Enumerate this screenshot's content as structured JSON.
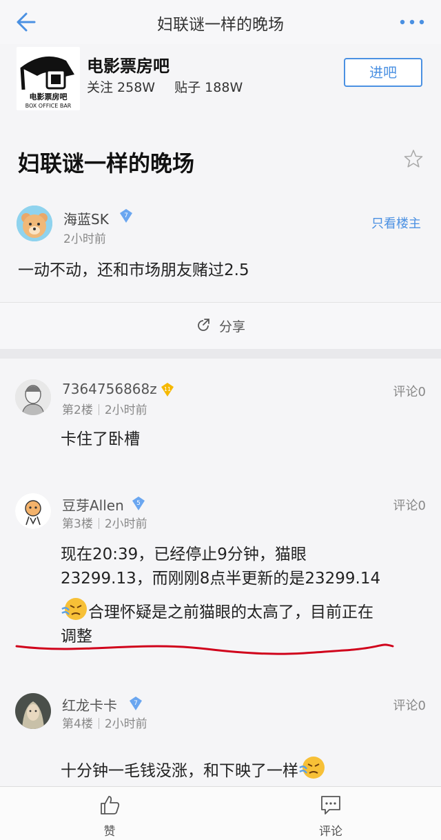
{
  "header": {
    "title": "妇联谜一样的晚场"
  },
  "forum": {
    "name": "电影票房吧",
    "followers": "关注 258W",
    "posts": "贴子 188W",
    "logo_text_cn": "电影票房吧",
    "logo_text_en": "BOX OFFICE BAR",
    "enter_label": "进吧"
  },
  "op": {
    "title": "妇联谜一样的晚场",
    "username": "海蓝SK",
    "level": "7",
    "time": "2小时前",
    "only_lz_label": "只看楼主",
    "content": "一动不动，还和市场朋友赌过2.5",
    "share_label": "分享"
  },
  "replies": [
    {
      "username": "7364756868z",
      "level": "11",
      "floor": "第2楼",
      "time": "2小时前",
      "comments": "评论0",
      "content": "卡住了卧槽"
    },
    {
      "username": "豆芽Allen",
      "level": "5",
      "floor": "第3楼",
      "time": "2小时前",
      "comments": "评论0",
      "content_1": "现在20:39，已经停止9分钟，猫眼",
      "content_2": "23299.13，而刚刚8点半更新的是23299.14",
      "content_3": "合理怀疑是之前猫眼的太高了，目前正在",
      "content_4": "调整"
    },
    {
      "username": "红龙卡卡",
      "level": "7",
      "floor": "第4楼",
      "time": "2小时前",
      "comments": "评论0",
      "content": "十分钟一毛钱没涨，和下映了一样"
    }
  ],
  "bottom": {
    "like_label": "赞",
    "comment_label": "评论"
  },
  "colors": {
    "accent": "#4a90e2",
    "annotation_red": "#d0021b"
  }
}
